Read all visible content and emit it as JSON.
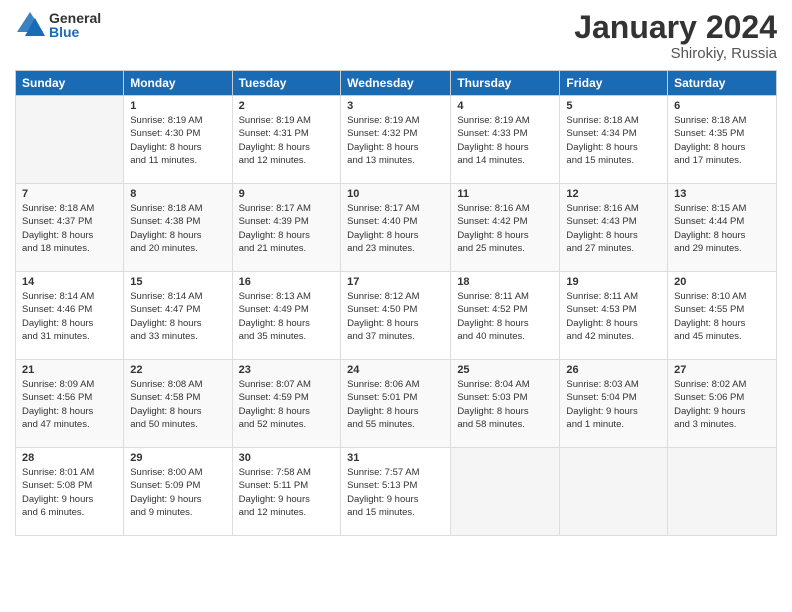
{
  "logo": {
    "general": "General",
    "blue": "Blue"
  },
  "title": {
    "month": "January 2024",
    "location": "Shirokiy, Russia"
  },
  "headers": [
    "Sunday",
    "Monday",
    "Tuesday",
    "Wednesday",
    "Thursday",
    "Friday",
    "Saturday"
  ],
  "weeks": [
    [
      {
        "day": "",
        "info": ""
      },
      {
        "day": "1",
        "info": "Sunrise: 8:19 AM\nSunset: 4:30 PM\nDaylight: 8 hours\nand 11 minutes."
      },
      {
        "day": "2",
        "info": "Sunrise: 8:19 AM\nSunset: 4:31 PM\nDaylight: 8 hours\nand 12 minutes."
      },
      {
        "day": "3",
        "info": "Sunrise: 8:19 AM\nSunset: 4:32 PM\nDaylight: 8 hours\nand 13 minutes."
      },
      {
        "day": "4",
        "info": "Sunrise: 8:19 AM\nSunset: 4:33 PM\nDaylight: 8 hours\nand 14 minutes."
      },
      {
        "day": "5",
        "info": "Sunrise: 8:18 AM\nSunset: 4:34 PM\nDaylight: 8 hours\nand 15 minutes."
      },
      {
        "day": "6",
        "info": "Sunrise: 8:18 AM\nSunset: 4:35 PM\nDaylight: 8 hours\nand 17 minutes."
      }
    ],
    [
      {
        "day": "7",
        "info": "Sunrise: 8:18 AM\nSunset: 4:37 PM\nDaylight: 8 hours\nand 18 minutes."
      },
      {
        "day": "8",
        "info": "Sunrise: 8:18 AM\nSunset: 4:38 PM\nDaylight: 8 hours\nand 20 minutes."
      },
      {
        "day": "9",
        "info": "Sunrise: 8:17 AM\nSunset: 4:39 PM\nDaylight: 8 hours\nand 21 minutes."
      },
      {
        "day": "10",
        "info": "Sunrise: 8:17 AM\nSunset: 4:40 PM\nDaylight: 8 hours\nand 23 minutes."
      },
      {
        "day": "11",
        "info": "Sunrise: 8:16 AM\nSunset: 4:42 PM\nDaylight: 8 hours\nand 25 minutes."
      },
      {
        "day": "12",
        "info": "Sunrise: 8:16 AM\nSunset: 4:43 PM\nDaylight: 8 hours\nand 27 minutes."
      },
      {
        "day": "13",
        "info": "Sunrise: 8:15 AM\nSunset: 4:44 PM\nDaylight: 8 hours\nand 29 minutes."
      }
    ],
    [
      {
        "day": "14",
        "info": "Sunrise: 8:14 AM\nSunset: 4:46 PM\nDaylight: 8 hours\nand 31 minutes."
      },
      {
        "day": "15",
        "info": "Sunrise: 8:14 AM\nSunset: 4:47 PM\nDaylight: 8 hours\nand 33 minutes."
      },
      {
        "day": "16",
        "info": "Sunrise: 8:13 AM\nSunset: 4:49 PM\nDaylight: 8 hours\nand 35 minutes."
      },
      {
        "day": "17",
        "info": "Sunrise: 8:12 AM\nSunset: 4:50 PM\nDaylight: 8 hours\nand 37 minutes."
      },
      {
        "day": "18",
        "info": "Sunrise: 8:11 AM\nSunset: 4:52 PM\nDaylight: 8 hours\nand 40 minutes."
      },
      {
        "day": "19",
        "info": "Sunrise: 8:11 AM\nSunset: 4:53 PM\nDaylight: 8 hours\nand 42 minutes."
      },
      {
        "day": "20",
        "info": "Sunrise: 8:10 AM\nSunset: 4:55 PM\nDaylight: 8 hours\nand 45 minutes."
      }
    ],
    [
      {
        "day": "21",
        "info": "Sunrise: 8:09 AM\nSunset: 4:56 PM\nDaylight: 8 hours\nand 47 minutes."
      },
      {
        "day": "22",
        "info": "Sunrise: 8:08 AM\nSunset: 4:58 PM\nDaylight: 8 hours\nand 50 minutes."
      },
      {
        "day": "23",
        "info": "Sunrise: 8:07 AM\nSunset: 4:59 PM\nDaylight: 8 hours\nand 52 minutes."
      },
      {
        "day": "24",
        "info": "Sunrise: 8:06 AM\nSunset: 5:01 PM\nDaylight: 8 hours\nand 55 minutes."
      },
      {
        "day": "25",
        "info": "Sunrise: 8:04 AM\nSunset: 5:03 PM\nDaylight: 8 hours\nand 58 minutes."
      },
      {
        "day": "26",
        "info": "Sunrise: 8:03 AM\nSunset: 5:04 PM\nDaylight: 9 hours\nand 1 minute."
      },
      {
        "day": "27",
        "info": "Sunrise: 8:02 AM\nSunset: 5:06 PM\nDaylight: 9 hours\nand 3 minutes."
      }
    ],
    [
      {
        "day": "28",
        "info": "Sunrise: 8:01 AM\nSunset: 5:08 PM\nDaylight: 9 hours\nand 6 minutes."
      },
      {
        "day": "29",
        "info": "Sunrise: 8:00 AM\nSunset: 5:09 PM\nDaylight: 9 hours\nand 9 minutes."
      },
      {
        "day": "30",
        "info": "Sunrise: 7:58 AM\nSunset: 5:11 PM\nDaylight: 9 hours\nand 12 minutes."
      },
      {
        "day": "31",
        "info": "Sunrise: 7:57 AM\nSunset: 5:13 PM\nDaylight: 9 hours\nand 15 minutes."
      },
      {
        "day": "",
        "info": ""
      },
      {
        "day": "",
        "info": ""
      },
      {
        "day": "",
        "info": ""
      }
    ]
  ]
}
